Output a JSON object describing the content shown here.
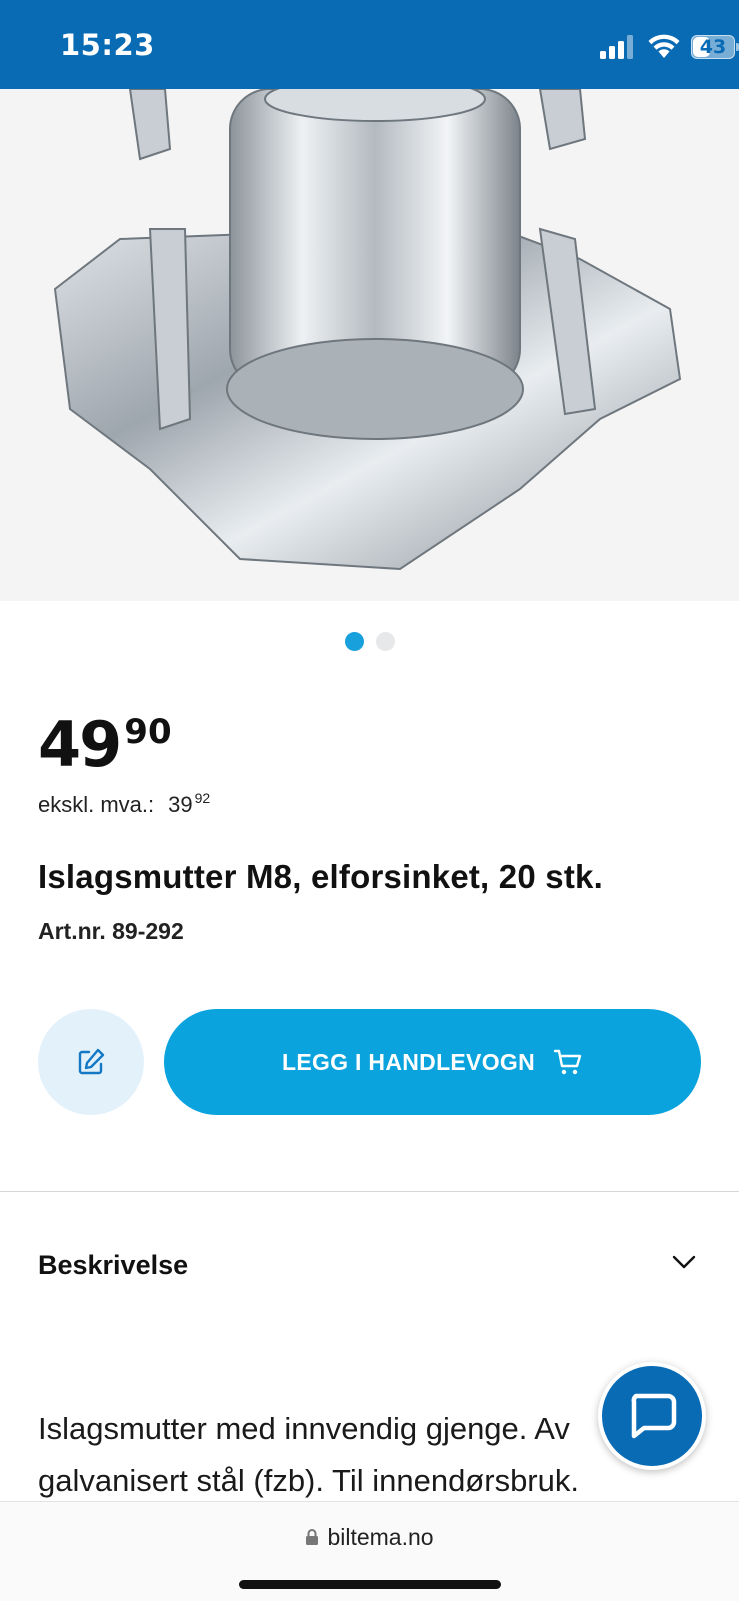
{
  "status_bar": {
    "time": "15:23",
    "battery_level": "43",
    "battery_fraction": 0.43,
    "background_color": "#0a6bb5",
    "icons": [
      "signal-icon",
      "wifi-icon",
      "battery-icon"
    ]
  },
  "gallery": {
    "image_alt": "Islagsmutter M8, elforsinket",
    "dot_count": 2,
    "active_index": 0,
    "active_color": "#18a0dd"
  },
  "product": {
    "price_integer": "49",
    "price_decimal": "90",
    "ex_vat_label": "ekskl. mva.:",
    "ex_vat_integer": "39",
    "ex_vat_decimal": "92",
    "title": "Islagsmutter M8, elforsinket, 20 stk.",
    "article_number": "Art.nr. 89-292"
  },
  "actions": {
    "wishlist_icon": "edit-icon",
    "add_to_cart_label": "LEGG I HANDLEVOGN",
    "cart_icon": "cart-icon",
    "cart_button_color": "#0aa3dd"
  },
  "description": {
    "header": "Beskrivelse",
    "expanded": false,
    "text": "Islagsmutter med innvendig gjenge. Av galvanisert stål (fzb). Til innendørsbruk."
  },
  "chat": {
    "icon": "chat-icon"
  },
  "browser": {
    "url": "biltema.no",
    "lock_icon": "lock-icon"
  }
}
